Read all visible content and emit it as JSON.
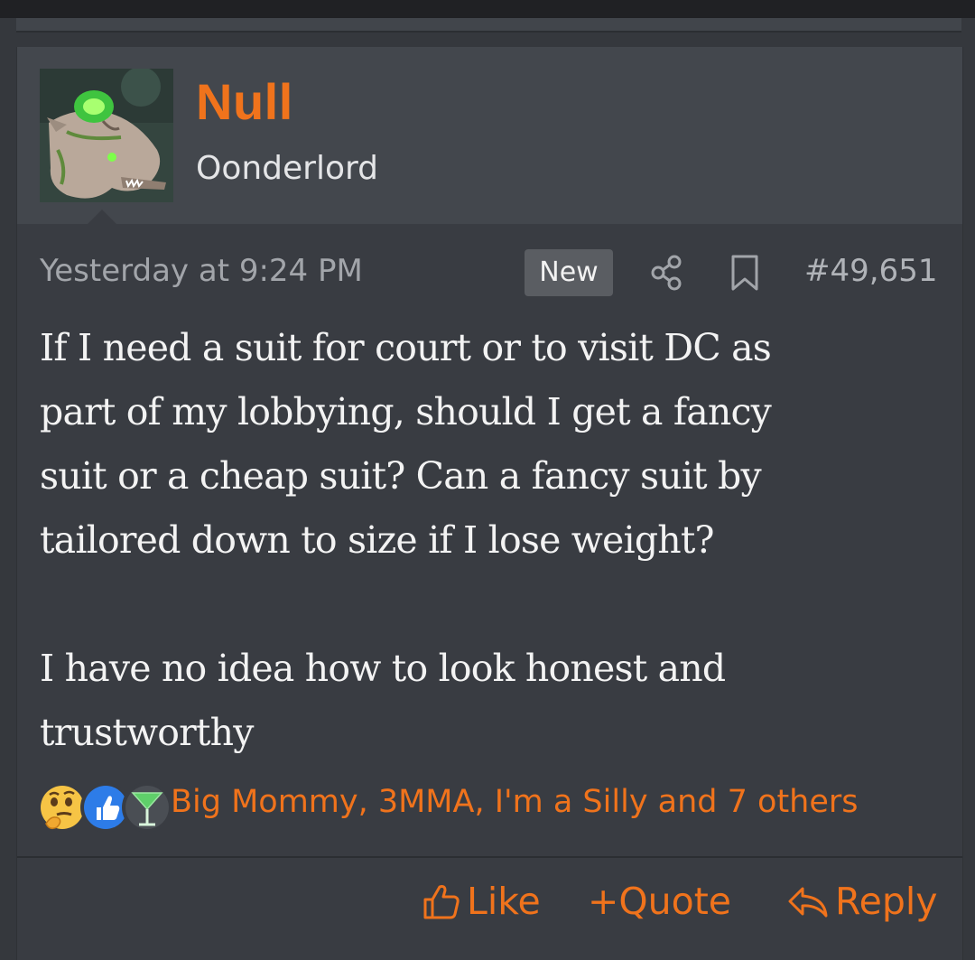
{
  "post": {
    "author": {
      "name": "Null",
      "title": "Oonderlord",
      "avatar": "green-dragon-avatar"
    },
    "timestamp": "Yesterday at 9:24 PM",
    "badge": "New",
    "post_number": "#49,651",
    "body": "If I need a suit for court or to visit DC as\npart of my lobbying, should I get a fancy\nsuit or a cheap suit? Can a fancy suit by\ntailored down to size if I lose weight?\n\nI have no idea how to look honest and\ntrustworthy",
    "reactions": {
      "icons": [
        "thinking-face-icon",
        "thumbs-up-icon",
        "cocktail-icon"
      ],
      "users_text": "Big Mommy, 3MMA, I'm a Silly and 7 others"
    },
    "actions": {
      "like": "Like",
      "quote_plus": "+",
      "quote": "Quote",
      "reply": "Reply"
    }
  },
  "colors": {
    "accent": "#f0731c",
    "background": "#393c42",
    "header": "#43474d",
    "text": "#f3f3f3",
    "muted": "#a2a5aa"
  }
}
